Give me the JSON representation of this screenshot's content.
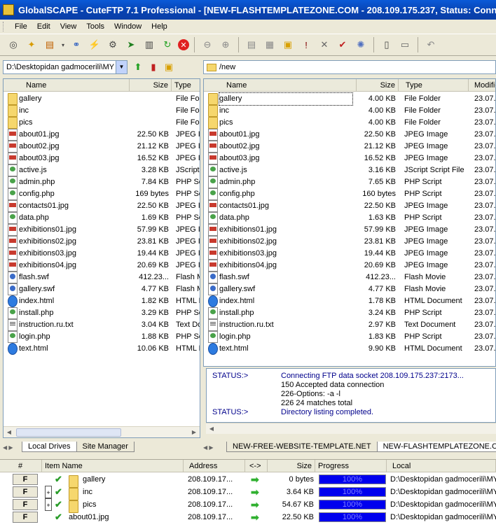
{
  "window": {
    "title": "GlobalSCAPE - CuteFTP 7.1 Professional - [NEW-FLASHTEMPLATEZONE.COM - 208.109.175.237, Status: Connected]"
  },
  "menu": [
    "File",
    "Edit",
    "View",
    "Tools",
    "Window",
    "Help"
  ],
  "local": {
    "path": "D:\\Desktopidan gadmocerili\\MY",
    "columns": {
      "name": "Name",
      "size": "Size",
      "type": "Type"
    },
    "files": [
      {
        "name": "gallery",
        "size": "",
        "type": "File Folder",
        "icon": "folder"
      },
      {
        "name": "inc",
        "size": "",
        "type": "File Folder",
        "icon": "folder"
      },
      {
        "name": "pics",
        "size": "",
        "type": "File Folder",
        "icon": "folder"
      },
      {
        "name": "about01.jpg",
        "size": "22.50 KB",
        "type": "JPEG Image",
        "icon": "jpg"
      },
      {
        "name": "about02.jpg",
        "size": "21.12 KB",
        "type": "JPEG Image",
        "icon": "jpg"
      },
      {
        "name": "about03.jpg",
        "size": "16.52 KB",
        "type": "JPEG Image",
        "icon": "jpg"
      },
      {
        "name": "active.js",
        "size": "3.28 KB",
        "type": "JScript Script File",
        "icon": "php"
      },
      {
        "name": "admin.php",
        "size": "7.84 KB",
        "type": "PHP Script",
        "icon": "php"
      },
      {
        "name": "config.php",
        "size": "169 bytes",
        "type": "PHP Script",
        "icon": "php"
      },
      {
        "name": "contacts01.jpg",
        "size": "22.50 KB",
        "type": "JPEG Image",
        "icon": "jpg"
      },
      {
        "name": "data.php",
        "size": "1.69 KB",
        "type": "PHP Script",
        "icon": "php"
      },
      {
        "name": "exhibitions01.jpg",
        "size": "57.99 KB",
        "type": "JPEG Image",
        "icon": "jpg"
      },
      {
        "name": "exhibitions02.jpg",
        "size": "23.81 KB",
        "type": "JPEG Image",
        "icon": "jpg"
      },
      {
        "name": "exhibitions03.jpg",
        "size": "19.44 KB",
        "type": "JPEG Image",
        "icon": "jpg"
      },
      {
        "name": "exhibitions04.jpg",
        "size": "20.69 KB",
        "type": "JPEG Image",
        "icon": "jpg"
      },
      {
        "name": "flash.swf",
        "size": "412.23...",
        "type": "Flash Movie",
        "icon": "swf"
      },
      {
        "name": "gallery.swf",
        "size": "4.77 KB",
        "type": "Flash Movie",
        "icon": "swf"
      },
      {
        "name": "index.html",
        "size": "1.82 KB",
        "type": "HTML Document",
        "icon": "html"
      },
      {
        "name": "install.php",
        "size": "3.29 KB",
        "type": "PHP Script",
        "icon": "php"
      },
      {
        "name": "instruction.ru.txt",
        "size": "3.04 KB",
        "type": "Text Document",
        "icon": "txt"
      },
      {
        "name": "login.php",
        "size": "1.88 KB",
        "type": "PHP Script",
        "icon": "php"
      },
      {
        "name": "text.html",
        "size": "10.06 KB",
        "type": "HTML Document",
        "icon": "html"
      }
    ],
    "tabs": [
      "Local Drives",
      "Site Manager"
    ]
  },
  "remote": {
    "path": "/new",
    "columns": {
      "name": "Name",
      "size": "Size",
      "type": "Type",
      "modified": "Modified"
    },
    "files": [
      {
        "name": "gallery",
        "size": "4.00 KB",
        "type": "File Folder",
        "modified": "23.07.",
        "icon": "folder"
      },
      {
        "name": "inc",
        "size": "4.00 KB",
        "type": "File Folder",
        "modified": "23.07.",
        "icon": "folder"
      },
      {
        "name": "pics",
        "size": "4.00 KB",
        "type": "File Folder",
        "modified": "23.07.",
        "icon": "folder"
      },
      {
        "name": "about01.jpg",
        "size": "22.50 KB",
        "type": "JPEG Image",
        "modified": "23.07.",
        "icon": "jpg"
      },
      {
        "name": "about02.jpg",
        "size": "21.12 KB",
        "type": "JPEG Image",
        "modified": "23.07.",
        "icon": "jpg"
      },
      {
        "name": "about03.jpg",
        "size": "16.52 KB",
        "type": "JPEG Image",
        "modified": "23.07.",
        "icon": "jpg"
      },
      {
        "name": "active.js",
        "size": "3.16 KB",
        "type": "JScript Script File",
        "modified": "23.07.",
        "icon": "php"
      },
      {
        "name": "admin.php",
        "size": "7.65 KB",
        "type": "PHP Script",
        "modified": "23.07.",
        "icon": "php"
      },
      {
        "name": "config.php",
        "size": "160 bytes",
        "type": "PHP Script",
        "modified": "23.07.",
        "icon": "php"
      },
      {
        "name": "contacts01.jpg",
        "size": "22.50 KB",
        "type": "JPEG Image",
        "modified": "23.07.",
        "icon": "jpg"
      },
      {
        "name": "data.php",
        "size": "1.63 KB",
        "type": "PHP Script",
        "modified": "23.07.",
        "icon": "php"
      },
      {
        "name": "exhibitions01.jpg",
        "size": "57.99 KB",
        "type": "JPEG Image",
        "modified": "23.07.",
        "icon": "jpg"
      },
      {
        "name": "exhibitions02.jpg",
        "size": "23.81 KB",
        "type": "JPEG Image",
        "modified": "23.07.",
        "icon": "jpg"
      },
      {
        "name": "exhibitions03.jpg",
        "size": "19.44 KB",
        "type": "JPEG Image",
        "modified": "23.07.",
        "icon": "jpg"
      },
      {
        "name": "exhibitions04.jpg",
        "size": "20.69 KB",
        "type": "JPEG Image",
        "modified": "23.07.",
        "icon": "jpg"
      },
      {
        "name": "flash.swf",
        "size": "412.23...",
        "type": "Flash Movie",
        "modified": "23.07.",
        "icon": "swf"
      },
      {
        "name": "gallery.swf",
        "size": "4.77 KB",
        "type": "Flash Movie",
        "modified": "23.07.",
        "icon": "swf"
      },
      {
        "name": "index.html",
        "size": "1.78 KB",
        "type": "HTML Document",
        "modified": "23.07.",
        "icon": "html"
      },
      {
        "name": "install.php",
        "size": "3.24 KB",
        "type": "PHP Script",
        "modified": "23.07.",
        "icon": "php"
      },
      {
        "name": "instruction.ru.txt",
        "size": "2.97 KB",
        "type": "Text Document",
        "modified": "23.07.",
        "icon": "txt"
      },
      {
        "name": "login.php",
        "size": "1.83 KB",
        "type": "PHP Script",
        "modified": "23.07.",
        "icon": "php"
      },
      {
        "name": "text.html",
        "size": "9.90 KB",
        "type": "HTML Document",
        "modified": "23.07.",
        "icon": "html"
      }
    ],
    "tabs": [
      "NEW-FREE-WEBSITE-TEMPLATE.NET",
      "NEW-FLASHTEMPLATEZONE.COM"
    ]
  },
  "log": [
    {
      "status": "STATUS:>",
      "message": "Connecting FTP data socket 208.109.175.237:2173...",
      "blue": true
    },
    {
      "status": "",
      "message": "150 Accepted data connection",
      "blue": false
    },
    {
      "status": "",
      "message": "226-Options: -a -l",
      "blue": false
    },
    {
      "status": "",
      "message": "226 24 matches total",
      "blue": false
    },
    {
      "status": "STATUS:>",
      "message": "Directory listing completed.",
      "blue": true
    }
  ],
  "queue": {
    "columns": {
      "num": "#",
      "item": "Item Name",
      "address": "Address",
      "dir": "<->",
      "size": "Size",
      "progress": "Progress",
      "local": "Local"
    },
    "items": [
      {
        "flag": "F",
        "name": "gallery",
        "address": "208.109.17...",
        "size": "0 bytes",
        "progress": "100%",
        "local": "D:\\Desktopidan gadmocerili\\MY",
        "expand": false,
        "folder": true
      },
      {
        "flag": "F",
        "name": "inc",
        "address": "208.109.17...",
        "size": "3.64 KB",
        "progress": "100%",
        "local": "D:\\Desktopidan gadmocerili\\MY",
        "expand": true,
        "folder": true
      },
      {
        "flag": "F",
        "name": "pics",
        "address": "208.109.17...",
        "size": "54.67 KB",
        "progress": "100%",
        "local": "D:\\Desktopidan gadmocerili\\MY",
        "expand": true,
        "folder": true
      },
      {
        "flag": "F",
        "name": "about01.jpg",
        "address": "208.109.17...",
        "size": "22.50 KB",
        "progress": "100%",
        "local": "D:\\Desktopidan gadmocerili\\MY",
        "expand": false,
        "folder": false
      }
    ]
  }
}
